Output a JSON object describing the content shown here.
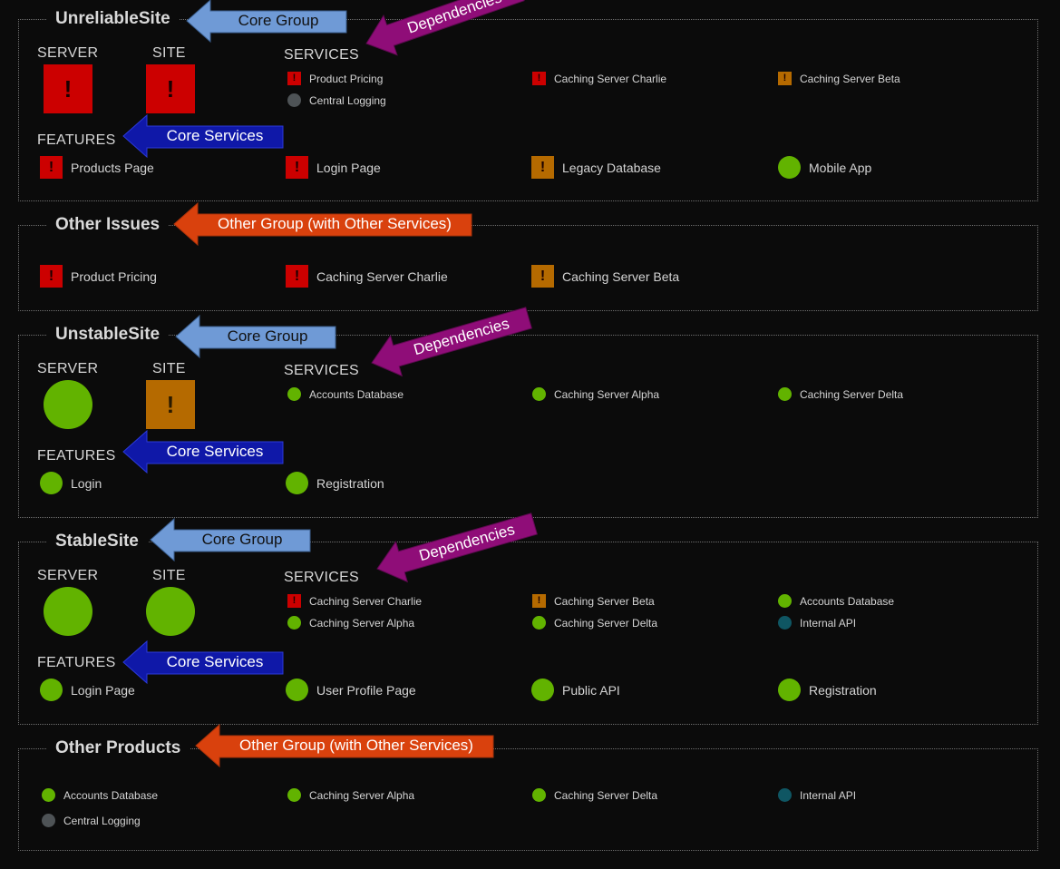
{
  "labels": {
    "server": "SERVER",
    "site": "SITE",
    "services": "SERVICES",
    "features": "FEATURES"
  },
  "annotations": {
    "core_group": "Core Group",
    "core_services": "Core Services",
    "dependencies": "Dependencies",
    "other_group": "Other Group (with Other Services)"
  },
  "status_colors": {
    "error": "#cc0000",
    "warning": "#b56a00",
    "ok": "#62b300",
    "unknown": "#4e5356",
    "info": "#0f5663"
  },
  "groups": [
    {
      "title": "UnreliableSite",
      "server_status": "error",
      "site_status": "error",
      "services": [
        {
          "name": "Product Pricing",
          "status": "error"
        },
        {
          "name": "Caching Server Charlie",
          "status": "error"
        },
        {
          "name": "Caching Server Beta",
          "status": "warning"
        },
        {
          "name": "Central Logging",
          "status": "unknown"
        }
      ],
      "features": [
        {
          "name": "Products Page",
          "status": "error"
        },
        {
          "name": "Login Page",
          "status": "error"
        },
        {
          "name": "Legacy Database",
          "status": "warning"
        },
        {
          "name": "Mobile App",
          "status": "ok"
        }
      ]
    },
    {
      "title": "Other Issues",
      "items": [
        {
          "name": "Product Pricing",
          "status": "error"
        },
        {
          "name": "Caching Server Charlie",
          "status": "error"
        },
        {
          "name": "Caching Server Beta",
          "status": "warning"
        }
      ]
    },
    {
      "title": "UnstableSite",
      "server_status": "ok",
      "site_status": "warning",
      "services": [
        {
          "name": "Accounts Database",
          "status": "ok"
        },
        {
          "name": "Caching Server Alpha",
          "status": "ok"
        },
        {
          "name": "Caching Server Delta",
          "status": "ok"
        }
      ],
      "features": [
        {
          "name": "Login",
          "status": "ok"
        },
        {
          "name": "Registration",
          "status": "ok"
        }
      ]
    },
    {
      "title": "StableSite",
      "server_status": "ok",
      "site_status": "ok",
      "services": [
        {
          "name": "Caching Server Charlie",
          "status": "error"
        },
        {
          "name": "Caching Server Beta",
          "status": "warning"
        },
        {
          "name": "Accounts Database",
          "status": "ok"
        },
        {
          "name": "Caching Server Alpha",
          "status": "ok"
        },
        {
          "name": "Caching Server Delta",
          "status": "ok"
        },
        {
          "name": "Internal API",
          "status": "info"
        }
      ],
      "features": [
        {
          "name": "Login Page",
          "status": "ok"
        },
        {
          "name": "User Profile Page",
          "status": "ok"
        },
        {
          "name": "Public API",
          "status": "ok"
        },
        {
          "name": "Registration",
          "status": "ok"
        }
      ]
    },
    {
      "title": "Other Products",
      "items": [
        {
          "name": "Accounts Database",
          "status": "ok"
        },
        {
          "name": "Caching Server Alpha",
          "status": "ok"
        },
        {
          "name": "Caching Server Delta",
          "status": "ok"
        },
        {
          "name": "Internal API",
          "status": "info"
        },
        {
          "name": "Central Logging",
          "status": "unknown"
        }
      ]
    }
  ]
}
